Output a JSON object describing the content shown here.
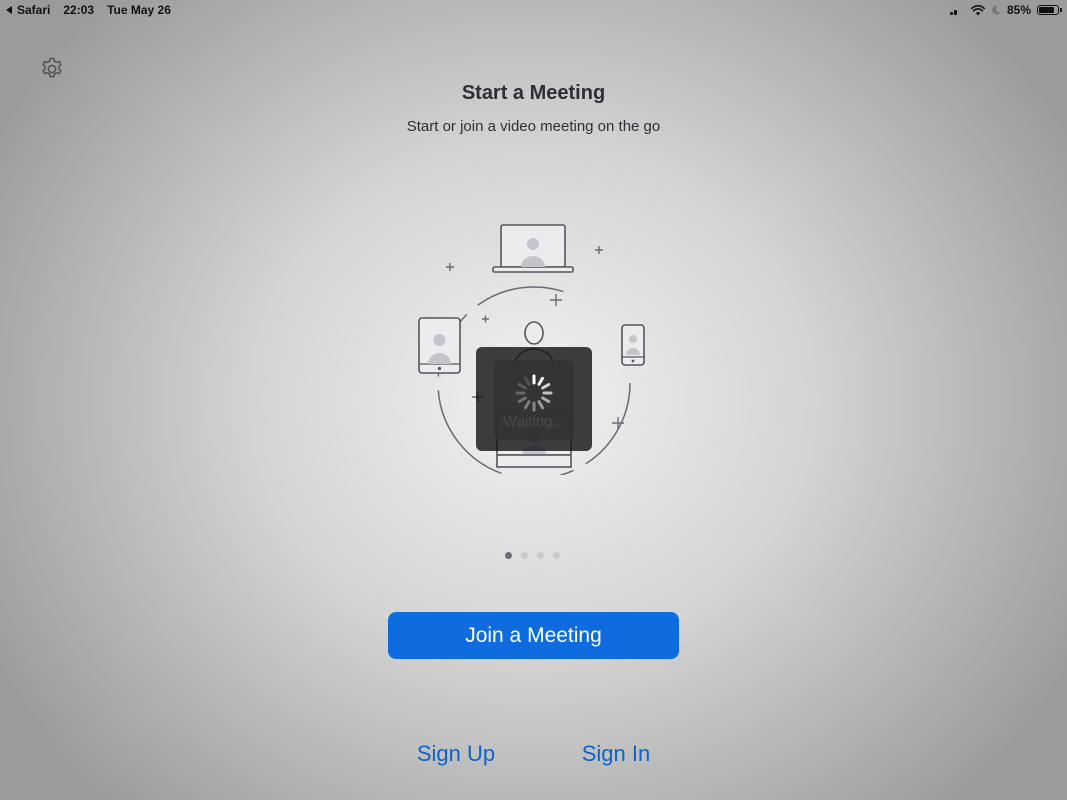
{
  "status_bar": {
    "back_app": "Safari",
    "time": "22:03",
    "date": "Tue May 26",
    "battery_text": "85%",
    "battery_level": 0.85,
    "signal_bars": 2
  },
  "header": {
    "settings_icon": "gear-icon",
    "title": "Start a Meeting",
    "subtitle": "Start or join a video meeting on the go"
  },
  "illustration": {
    "devices": [
      "laptop-icon",
      "tablet-icon",
      "phone-icon",
      "computer-icon",
      "person-icon"
    ]
  },
  "overlay": {
    "waiting_text": "Waiting..."
  },
  "pager": {
    "count": 4,
    "active_index": 0
  },
  "actions": {
    "join_label": "Join a Meeting",
    "signup_label": "Sign Up",
    "signin_label": "Sign In"
  },
  "colors": {
    "primary_button": "#0e6cde",
    "link": "#0e63c8",
    "text": "#2e2e36",
    "dot_active": "#6f6f78",
    "dot_inactive": "#c6c6cc"
  }
}
